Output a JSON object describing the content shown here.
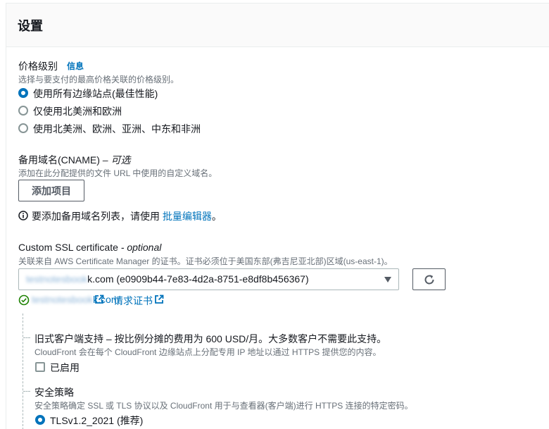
{
  "header": {
    "title": "设置"
  },
  "price_class": {
    "label": "价格级别",
    "info_link": "信息",
    "description": "选择与要支付的最高价格关联的价格级别。",
    "options": [
      {
        "label": "使用所有边缘站点(最佳性能)",
        "selected": true
      },
      {
        "label": "仅使用北美洲和欧洲",
        "selected": false
      },
      {
        "label": "使用北美洲、欧洲、亚洲、中东和非洲",
        "selected": false
      }
    ]
  },
  "cname": {
    "label": "备用域名(CNAME)",
    "optional": "– 可选",
    "description": "添加在此分配提供的文件 URL 中使用的自定义域名。",
    "add_button": "添加项目",
    "hint_prefix": "要添加备用域名列表，请使用",
    "hint_link": "批量编辑器",
    "hint_suffix": "。"
  },
  "ssl": {
    "label": "Custom SSL certificate",
    "optional": "- optional",
    "description": "关联来自 AWS Certificate Manager 的证书。证书必须位于美国东部(弗吉尼亚北部)区域(us-east-1)。",
    "selected_blurred": "testnotesbook",
    "selected_value": "k.com (e0909b44-7e83-4d2a-8751-e8df8b456367)",
    "status_blurred": "testnotesbook",
    "status_domain": "k.com",
    "request_link": "请求证书"
  },
  "legacy": {
    "label": "旧式客户端支持 – 按比例分摊的费用为 600 USD/月。大多数客户不需要此支持。",
    "description": "CloudFront 会在每个 CloudFront 边缘站点上分配专用 IP 地址以通过 HTTPS 提供您的内容。",
    "checkbox_label": "已启用"
  },
  "security_policy": {
    "label": "安全策略",
    "description": "安全策略确定 SSL 或 TLS 协议以及 CloudFront 用于与查看器(客户端)进行 HTTPS 连接的特定密码。",
    "selected_option": "TLSv1.2_2021 (推荐)"
  }
}
